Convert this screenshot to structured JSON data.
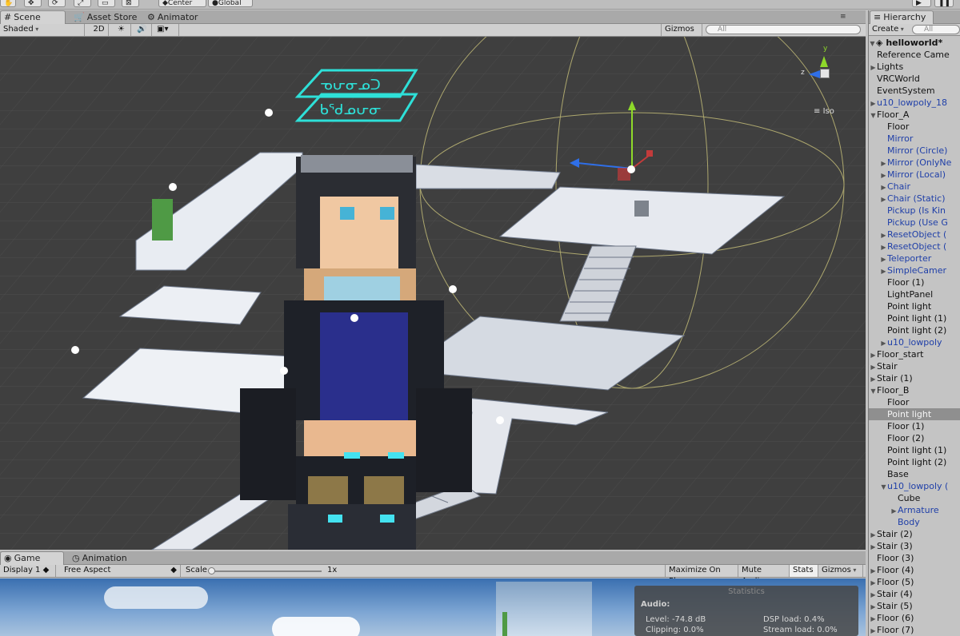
{
  "top_buttons": {
    "center": "Center",
    "global": "Global"
  },
  "scene_tabs": [
    {
      "label": "Scene",
      "active": true
    },
    {
      "label": "Asset Store",
      "active": false
    },
    {
      "label": "Animator",
      "active": false
    }
  ],
  "scene_toolbar": {
    "shading": "Shaded",
    "mode_2d": "2D",
    "gizmos": "Gizmos",
    "search_placeholder": "All"
  },
  "view_gizmo": {
    "y": "y",
    "z": "z",
    "proj": "Iso"
  },
  "sign": {
    "line1": "ᓀᕂᓂᓄᑐ",
    "line2": "ᑲᖁᓄᕂᓂ"
  },
  "hierarchy": {
    "tab": "Hierarchy",
    "create": "Create",
    "search_placeholder": "All",
    "scene": "helloworld*",
    "items": [
      {
        "label": "Reference Came",
        "indent": 1,
        "arrow": "",
        "prefab": false,
        "selected": false
      },
      {
        "label": "Lights",
        "indent": 1,
        "arrow": "right",
        "prefab": false,
        "selected": false
      },
      {
        "label": "VRCWorld",
        "indent": 1,
        "arrow": "",
        "prefab": false,
        "selected": false
      },
      {
        "label": "EventSystem",
        "indent": 1,
        "arrow": "",
        "prefab": false,
        "selected": false
      },
      {
        "label": "u10_lowpoly_18",
        "indent": 1,
        "arrow": "right",
        "prefab": true,
        "selected": false
      },
      {
        "label": "Floor_A",
        "indent": 1,
        "arrow": "down",
        "prefab": false,
        "selected": false
      },
      {
        "label": "Floor",
        "indent": 2,
        "arrow": "",
        "prefab": false,
        "selected": false
      },
      {
        "label": "Mirror",
        "indent": 2,
        "arrow": "",
        "prefab": true,
        "selected": false
      },
      {
        "label": "Mirror (Circle)",
        "indent": 2,
        "arrow": "",
        "prefab": true,
        "selected": false
      },
      {
        "label": "Mirror (OnlyNe",
        "indent": 2,
        "arrow": "right",
        "prefab": true,
        "selected": false
      },
      {
        "label": "Mirror (Local)",
        "indent": 2,
        "arrow": "right",
        "prefab": true,
        "selected": false
      },
      {
        "label": "Chair",
        "indent": 2,
        "arrow": "right",
        "prefab": true,
        "selected": false
      },
      {
        "label": "Chair (Static)",
        "indent": 2,
        "arrow": "right",
        "prefab": true,
        "selected": false
      },
      {
        "label": "Pickup (Is Kin",
        "indent": 2,
        "arrow": "",
        "prefab": true,
        "selected": false
      },
      {
        "label": "Pickup (Use G",
        "indent": 2,
        "arrow": "",
        "prefab": true,
        "selected": false
      },
      {
        "label": "ResetObject (",
        "indent": 2,
        "arrow": "right",
        "prefab": true,
        "selected": false
      },
      {
        "label": "ResetObject (",
        "indent": 2,
        "arrow": "right",
        "prefab": true,
        "selected": false
      },
      {
        "label": "Teleporter",
        "indent": 2,
        "arrow": "right",
        "prefab": true,
        "selected": false
      },
      {
        "label": "SimpleCamer",
        "indent": 2,
        "arrow": "right",
        "prefab": true,
        "selected": false
      },
      {
        "label": "Floor (1)",
        "indent": 2,
        "arrow": "",
        "prefab": false,
        "selected": false
      },
      {
        "label": "LightPanel",
        "indent": 2,
        "arrow": "",
        "prefab": false,
        "selected": false
      },
      {
        "label": "Point light",
        "indent": 2,
        "arrow": "",
        "prefab": false,
        "selected": false
      },
      {
        "label": "Point light (1)",
        "indent": 2,
        "arrow": "",
        "prefab": false,
        "selected": false
      },
      {
        "label": "Point light (2)",
        "indent": 2,
        "arrow": "",
        "prefab": false,
        "selected": false
      },
      {
        "label": "u10_lowpoly",
        "indent": 2,
        "arrow": "right",
        "prefab": true,
        "selected": false
      },
      {
        "label": "Floor_start",
        "indent": 1,
        "arrow": "right",
        "prefab": false,
        "selected": false
      },
      {
        "label": "Stair",
        "indent": 1,
        "arrow": "right",
        "prefab": false,
        "selected": false
      },
      {
        "label": "Stair (1)",
        "indent": 1,
        "arrow": "right",
        "prefab": false,
        "selected": false
      },
      {
        "label": "Floor_B",
        "indent": 1,
        "arrow": "down",
        "prefab": false,
        "selected": false
      },
      {
        "label": "Floor",
        "indent": 2,
        "arrow": "",
        "prefab": false,
        "selected": false
      },
      {
        "label": "Point light",
        "indent": 2,
        "arrow": "",
        "prefab": false,
        "selected": true
      },
      {
        "label": "Floor (1)",
        "indent": 2,
        "arrow": "",
        "prefab": false,
        "selected": false
      },
      {
        "label": "Floor (2)",
        "indent": 2,
        "arrow": "",
        "prefab": false,
        "selected": false
      },
      {
        "label": "Point light (1)",
        "indent": 2,
        "arrow": "",
        "prefab": false,
        "selected": false
      },
      {
        "label": "Point light (2)",
        "indent": 2,
        "arrow": "",
        "prefab": false,
        "selected": false
      },
      {
        "label": "Base",
        "indent": 2,
        "arrow": "",
        "prefab": false,
        "selected": false
      },
      {
        "label": "u10_lowpoly (",
        "indent": 2,
        "arrow": "down",
        "prefab": true,
        "selected": false
      },
      {
        "label": "Cube",
        "indent": 3,
        "arrow": "",
        "prefab": false,
        "selected": false
      },
      {
        "label": "Armature",
        "indent": 3,
        "arrow": "right",
        "prefab": true,
        "selected": false
      },
      {
        "label": "Body",
        "indent": 3,
        "arrow": "",
        "prefab": true,
        "selected": false
      },
      {
        "label": "Stair (2)",
        "indent": 1,
        "arrow": "right",
        "prefab": false,
        "selected": false
      },
      {
        "label": "Stair (3)",
        "indent": 1,
        "arrow": "right",
        "prefab": false,
        "selected": false
      },
      {
        "label": "Floor (3)",
        "indent": 1,
        "arrow": "",
        "prefab": false,
        "selected": false
      },
      {
        "label": "Floor (4)",
        "indent": 1,
        "arrow": "right",
        "prefab": false,
        "selected": false
      },
      {
        "label": "Floor (5)",
        "indent": 1,
        "arrow": "right",
        "prefab": false,
        "selected": false
      },
      {
        "label": "Stair (4)",
        "indent": 1,
        "arrow": "right",
        "prefab": false,
        "selected": false
      },
      {
        "label": "Stair (5)",
        "indent": 1,
        "arrow": "right",
        "prefab": false,
        "selected": false
      },
      {
        "label": "Floor (6)",
        "indent": 1,
        "arrow": "right",
        "prefab": false,
        "selected": false
      },
      {
        "label": "Floor (7)",
        "indent": 1,
        "arrow": "right",
        "prefab": false,
        "selected": false
      }
    ]
  },
  "game_tabs": [
    {
      "label": "Game",
      "active": true
    },
    {
      "label": "Animation",
      "active": false
    }
  ],
  "game_toolbar": {
    "display": "Display 1",
    "aspect": "Free Aspect",
    "scale_label": "Scale",
    "scale_value": "1x",
    "maximize": "Maximize On Play",
    "mute": "Mute Audio",
    "stats": "Stats",
    "gizmos": "Gizmos"
  },
  "stats": {
    "title": "Statistics",
    "audio_label": "Audio:",
    "level": "Level: -74.8 dB",
    "clipping": "Clipping: 0.0%",
    "dsp": "DSP load: 0.4%",
    "stream": "Stream load: 0.0%"
  }
}
